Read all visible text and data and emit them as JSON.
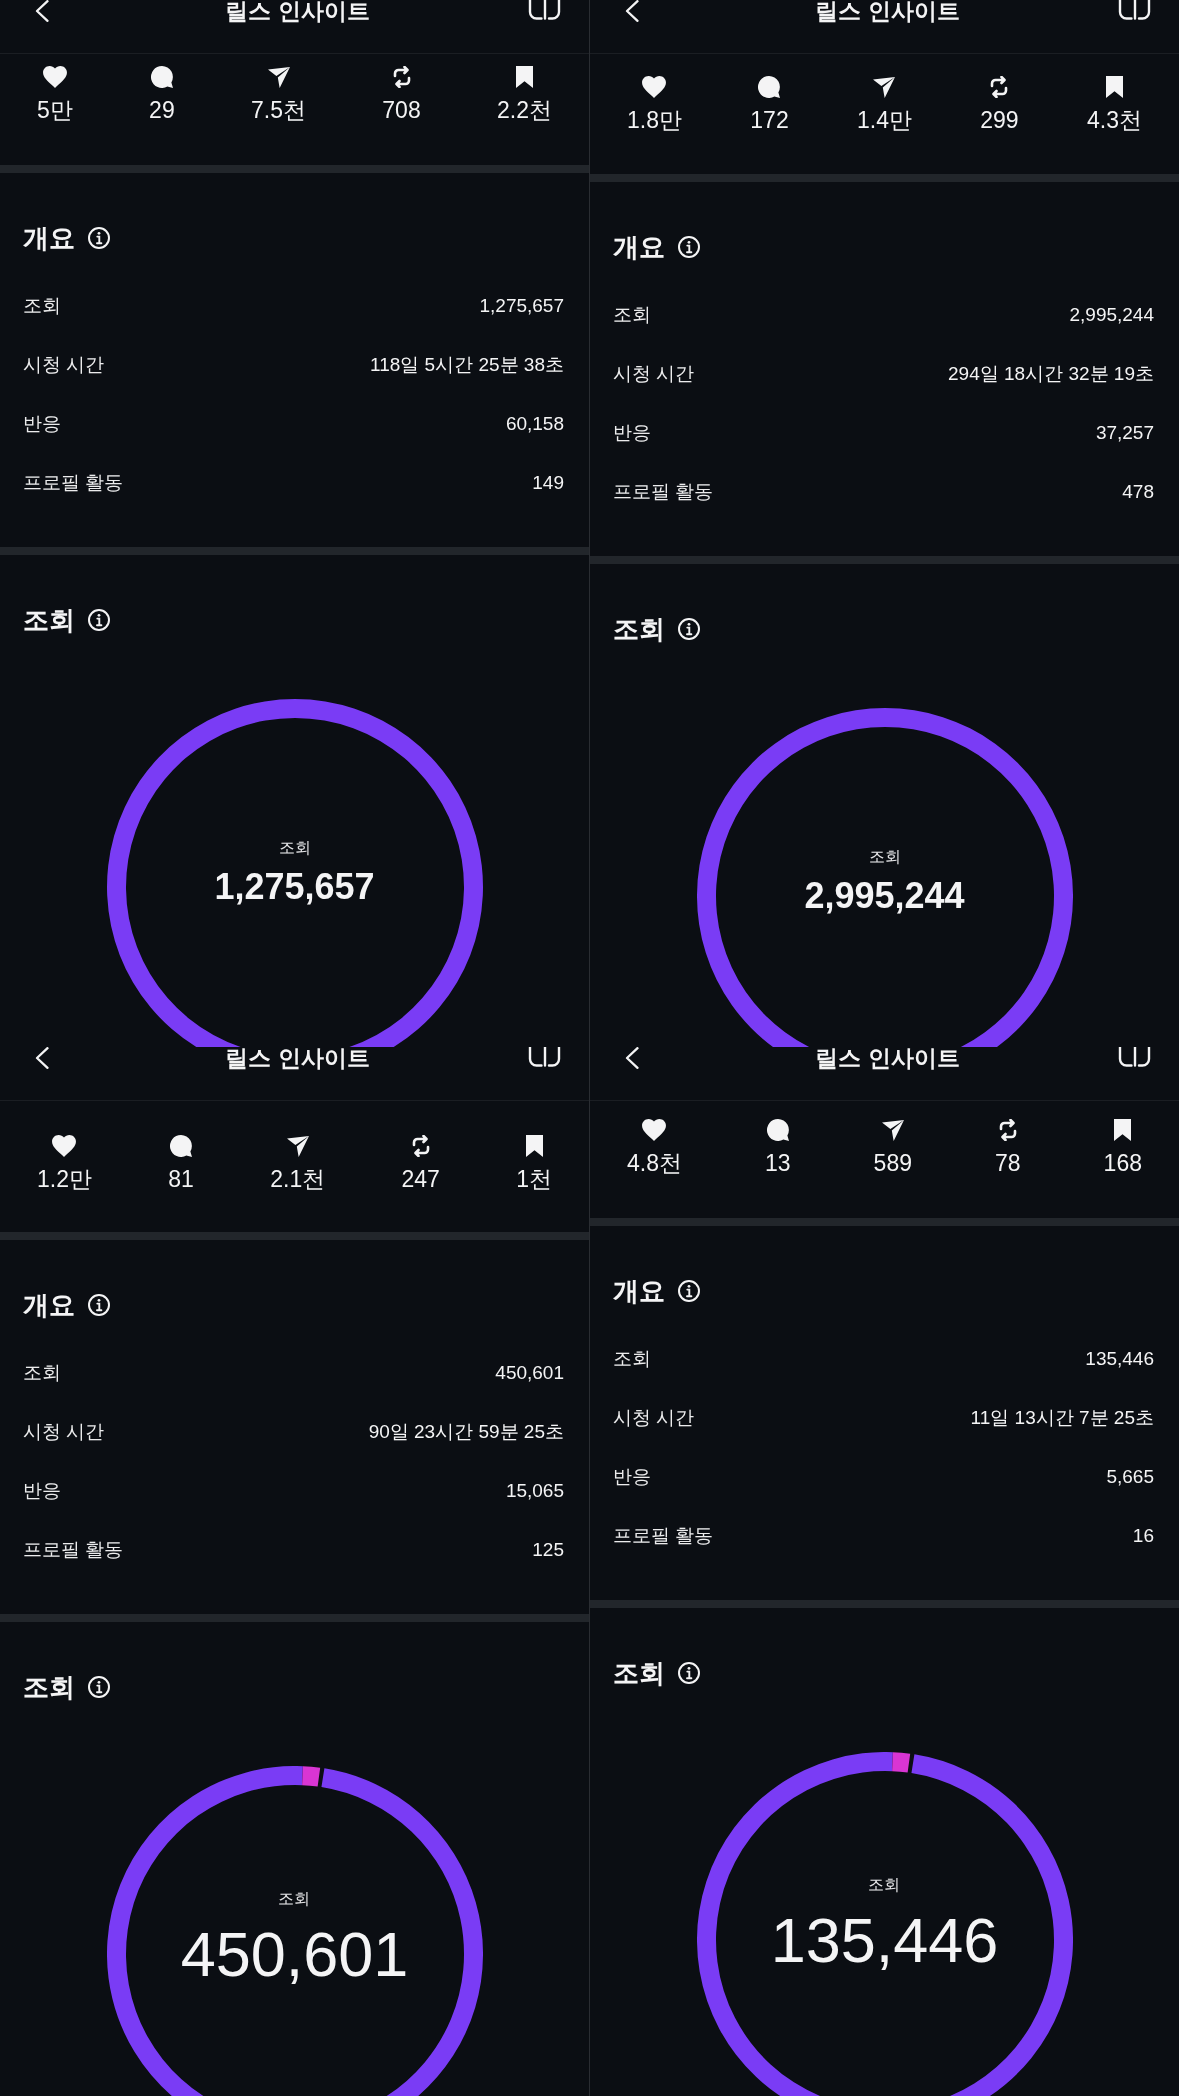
{
  "panels": [
    {
      "header": {
        "title": "릴스 인사이트"
      },
      "stats": [
        {
          "kind": "likes",
          "value": "5만"
        },
        {
          "kind": "comments",
          "value": "29"
        },
        {
          "kind": "shares",
          "value": "7.5천"
        },
        {
          "kind": "reposts",
          "value": "708"
        },
        {
          "kind": "saves",
          "value": "2.2천"
        }
      ],
      "overview": {
        "title": "개요",
        "rows": [
          {
            "label": "조회",
            "value": "1,275,657"
          },
          {
            "label": "시청 시간",
            "value": "118일 5시간 25분 38초"
          },
          {
            "label": "반응",
            "value": "60,158"
          },
          {
            "label": "프로필 활동",
            "value": "149"
          }
        ]
      },
      "views": {
        "title": "조회",
        "ring_label": "조회",
        "total": "1,275,657",
        "segments": [
          {
            "color": "#7a3cf5"
          }
        ]
      }
    },
    {
      "header": {
        "title": "릴스 인사이트"
      },
      "stats": [
        {
          "kind": "likes",
          "value": "1.8만"
        },
        {
          "kind": "comments",
          "value": "172"
        },
        {
          "kind": "shares",
          "value": "1.4만"
        },
        {
          "kind": "reposts",
          "value": "299"
        },
        {
          "kind": "saves",
          "value": "4.3천"
        }
      ],
      "overview": {
        "title": "개요",
        "rows": [
          {
            "label": "조회",
            "value": "2,995,244"
          },
          {
            "label": "시청 시간",
            "value": "294일 18시간 32분 19초"
          },
          {
            "label": "반응",
            "value": "37,257"
          },
          {
            "label": "프로필 활동",
            "value": "478"
          }
        ]
      },
      "views": {
        "title": "조회",
        "ring_label": "조회",
        "total": "2,995,244",
        "segments": [
          {
            "color": "#7a3cf5"
          }
        ]
      }
    },
    {
      "header": {
        "title": "릴스 인사이트"
      },
      "stats": [
        {
          "kind": "likes",
          "value": "1.2만"
        },
        {
          "kind": "comments",
          "value": "81"
        },
        {
          "kind": "shares",
          "value": "2.1천"
        },
        {
          "kind": "reposts",
          "value": "247"
        },
        {
          "kind": "saves",
          "value": "1천"
        }
      ],
      "overview": {
        "title": "개요",
        "rows": [
          {
            "label": "조회",
            "value": "450,601"
          },
          {
            "label": "시청 시간",
            "value": "90일 23시간 59분 25초"
          },
          {
            "label": "반응",
            "value": "15,065"
          },
          {
            "label": "프로필 활동",
            "value": "125"
          }
        ]
      },
      "views": {
        "title": "조회",
        "ring_label": "조회",
        "total": "450,601",
        "segments": [
          {
            "color": "#7a3cf5"
          },
          {
            "color": "#d935d3"
          }
        ]
      }
    },
    {
      "header": {
        "title": "릴스 인사이트"
      },
      "stats": [
        {
          "kind": "likes",
          "value": "4.8천"
        },
        {
          "kind": "comments",
          "value": "13"
        },
        {
          "kind": "shares",
          "value": "589"
        },
        {
          "kind": "reposts",
          "value": "78"
        },
        {
          "kind": "saves",
          "value": "168"
        }
      ],
      "overview": {
        "title": "개요",
        "rows": [
          {
            "label": "조회",
            "value": "135,446"
          },
          {
            "label": "시청 시간",
            "value": "11일 13시간 7분 25초"
          },
          {
            "label": "반응",
            "value": "5,665"
          },
          {
            "label": "프로필 활동",
            "value": "16"
          }
        ]
      },
      "views": {
        "title": "조회",
        "ring_label": "조회",
        "total": "135,446",
        "segments": [
          {
            "color": "#7a3cf5"
          },
          {
            "color": "#d935d3"
          }
        ]
      }
    }
  ]
}
